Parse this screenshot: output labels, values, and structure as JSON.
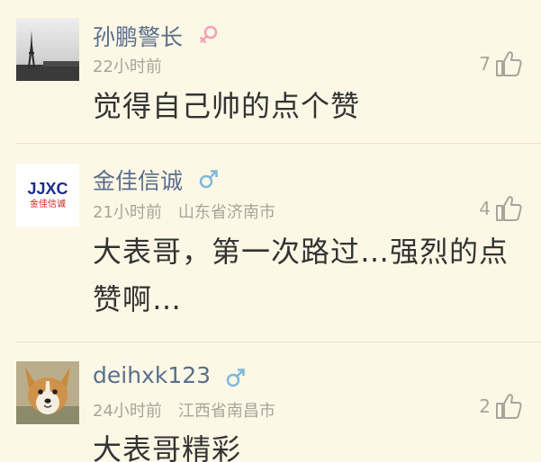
{
  "comments": [
    {
      "username": "孙鹏警长",
      "gender": "female",
      "avatar": "eiffel-tower-photo",
      "time": "22小时前",
      "location": "",
      "likes": "7",
      "text": "觉得自己帅的点个赞"
    },
    {
      "username": "金佳信诚",
      "gender": "male",
      "avatar": "jjxc-logo",
      "avatar_logo_text": "JJXC",
      "avatar_logo_sub": "金佳信诚",
      "time": "21小时前",
      "location": "山东省济南市",
      "likes": "4",
      "text": "大表哥，第一次路过…强烈的点赞啊…"
    },
    {
      "username": "deihxk123",
      "gender": "male",
      "avatar": "corgi-dog-photo",
      "time": "24小时前",
      "location": "江西省南昌市",
      "likes": "2",
      "text": "大表哥精彩"
    }
  ],
  "colors": {
    "background": "#fdf8e6",
    "username": "#5a6e8c",
    "meta": "#a8a49a",
    "text": "#333333",
    "female": "#f3a0b8",
    "male": "#7eb8de"
  },
  "icons": {
    "like": "thumbs-up-icon",
    "female": "female-symbol-icon",
    "male": "male-symbol-icon"
  }
}
